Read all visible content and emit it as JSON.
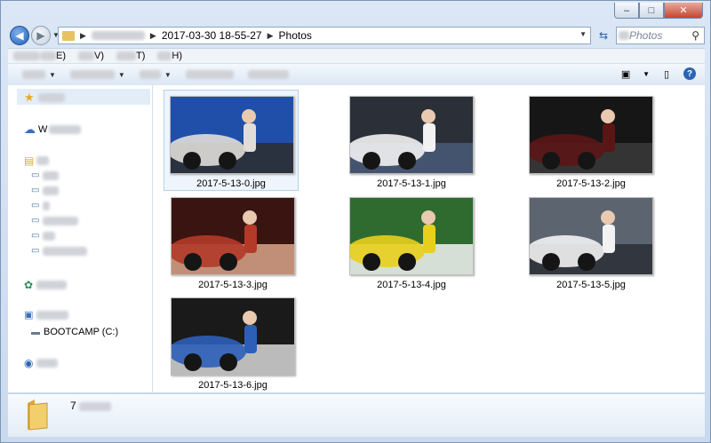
{
  "window": {
    "caption_min": "–",
    "caption_max": "□",
    "caption_close": "✕"
  },
  "address": {
    "crumb_date": "2017-03-30 18-55-27",
    "crumb_folder": "Photos",
    "search_placeholder": "Photos"
  },
  "menu": {
    "items": [
      "E)",
      "V)",
      "T)",
      "H)"
    ]
  },
  "nav": {
    "items": [
      "W",
      "BOOTCAMP (C:)"
    ]
  },
  "files": [
    {
      "name": "2017-5-13-0.jpg",
      "colors": [
        "#1f4fa8",
        "#e0ddd8",
        "#2d2d2d"
      ]
    },
    {
      "name": "2017-5-13-1.jpg",
      "colors": [
        "#2a2f38",
        "#f2f2f2",
        "#4a5a78"
      ]
    },
    {
      "name": "2017-5-13-2.jpg",
      "colors": [
        "#161616",
        "#5a1515",
        "#3a3a3a"
      ]
    },
    {
      "name": "2017-5-13-3.jpg",
      "colors": [
        "#3a1410",
        "#b33a28",
        "#d9a58a"
      ]
    },
    {
      "name": "2017-5-13-4.jpg",
      "colors": [
        "#2f6b2f",
        "#e9cf1c",
        "#f3f3f3"
      ]
    },
    {
      "name": "2017-5-13-5.jpg",
      "colors": [
        "#5c6470",
        "#f2f2f2",
        "#2a2f36"
      ]
    },
    {
      "name": "2017-5-13-6.jpg",
      "colors": [
        "#1a1a1a",
        "#2d5fb8",
        "#d8d8d8"
      ]
    }
  ],
  "status": {
    "count_prefix": "7"
  },
  "colors": {
    "accent": "#2c63b4",
    "folder": "#e8c260"
  }
}
